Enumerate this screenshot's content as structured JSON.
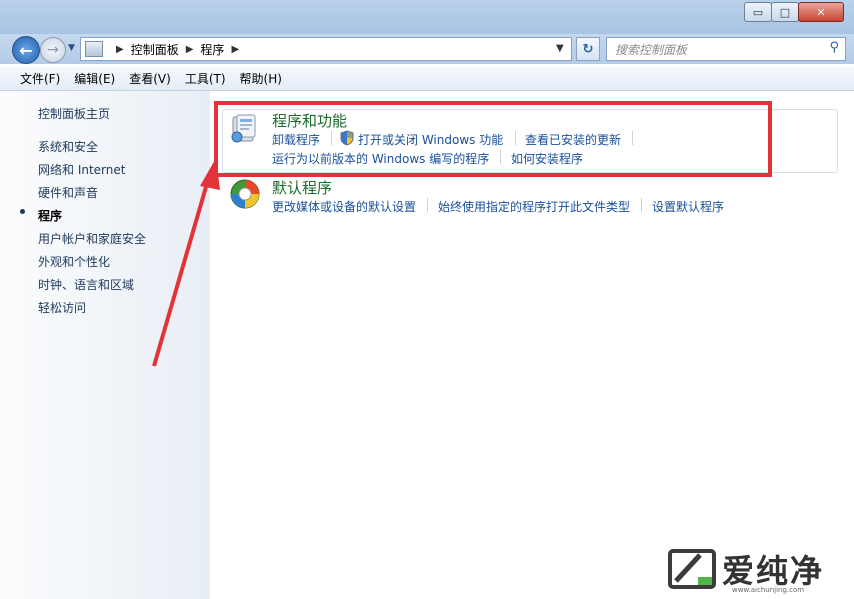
{
  "window": {
    "controls": {
      "minimize": "▭",
      "maximize": "□",
      "close": "✕"
    }
  },
  "navigation": {
    "back_icon": "back-arrow-icon",
    "forward_icon": "forward-arrow-icon",
    "breadcrumbs": [
      "控制面板",
      "程序"
    ],
    "search_placeholder": "搜索控制面板"
  },
  "menubar": {
    "items": [
      "文件(F)",
      "编辑(E)",
      "查看(V)",
      "工具(T)",
      "帮助(H)"
    ]
  },
  "sidebar": {
    "items": [
      {
        "label": "控制面板主页"
      },
      {
        "label": "系统和安全"
      },
      {
        "label": "网络和 Internet"
      },
      {
        "label": "硬件和声音"
      },
      {
        "label": "程序",
        "current": true
      },
      {
        "label": "用户帐户和家庭安全"
      },
      {
        "label": "外观和个性化"
      },
      {
        "label": "时钟、语言和区域"
      },
      {
        "label": "轻松访问"
      }
    ]
  },
  "main": {
    "programs_features": {
      "title": "程序和功能",
      "links": [
        "卸载程序",
        "打开或关闭 Windows 功能",
        "查看已安装的更新",
        "运行为以前版本的 Windows 编写的程序",
        "如何安装程序"
      ]
    },
    "default_programs": {
      "title": "默认程序",
      "links": [
        "更改媒体或设备的默认设置",
        "始终使用指定的程序打开此文件类型",
        "设置默认程序"
      ]
    }
  },
  "annotation": {
    "color": "#e2333a"
  },
  "watermark": {
    "text": "爱纯净",
    "url": "www.aichunjing.com"
  }
}
